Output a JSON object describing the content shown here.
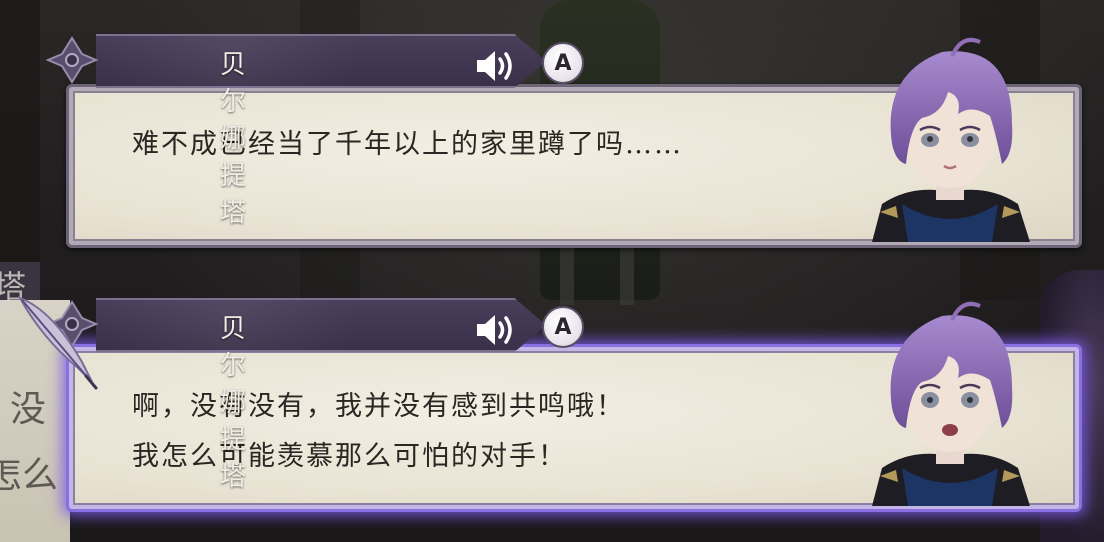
{
  "background": {
    "left_partial_chars": [
      "塔",
      "没",
      "怎么"
    ]
  },
  "dialogs": [
    {
      "speaker": "贝尔娜提塔",
      "button_hint": "A",
      "lines": [
        "难不成已经当了千年以上的家里蹲了吗……"
      ],
      "active": false
    },
    {
      "speaker": "贝尔娜提塔",
      "button_hint": "A",
      "lines": [
        "啊，没有没有，我并没有感到共鸣哦！",
        "我怎么可能羡慕那么可怕的对手！"
      ],
      "active": true
    }
  ],
  "colors": {
    "active_glow": "#8a6fe0",
    "nameplate": "#4a3f5b",
    "hair": "#8f6fb5"
  },
  "icons": [
    "speaker-icon",
    "a-button-icon",
    "quill-icon",
    "ornament-icon"
  ]
}
